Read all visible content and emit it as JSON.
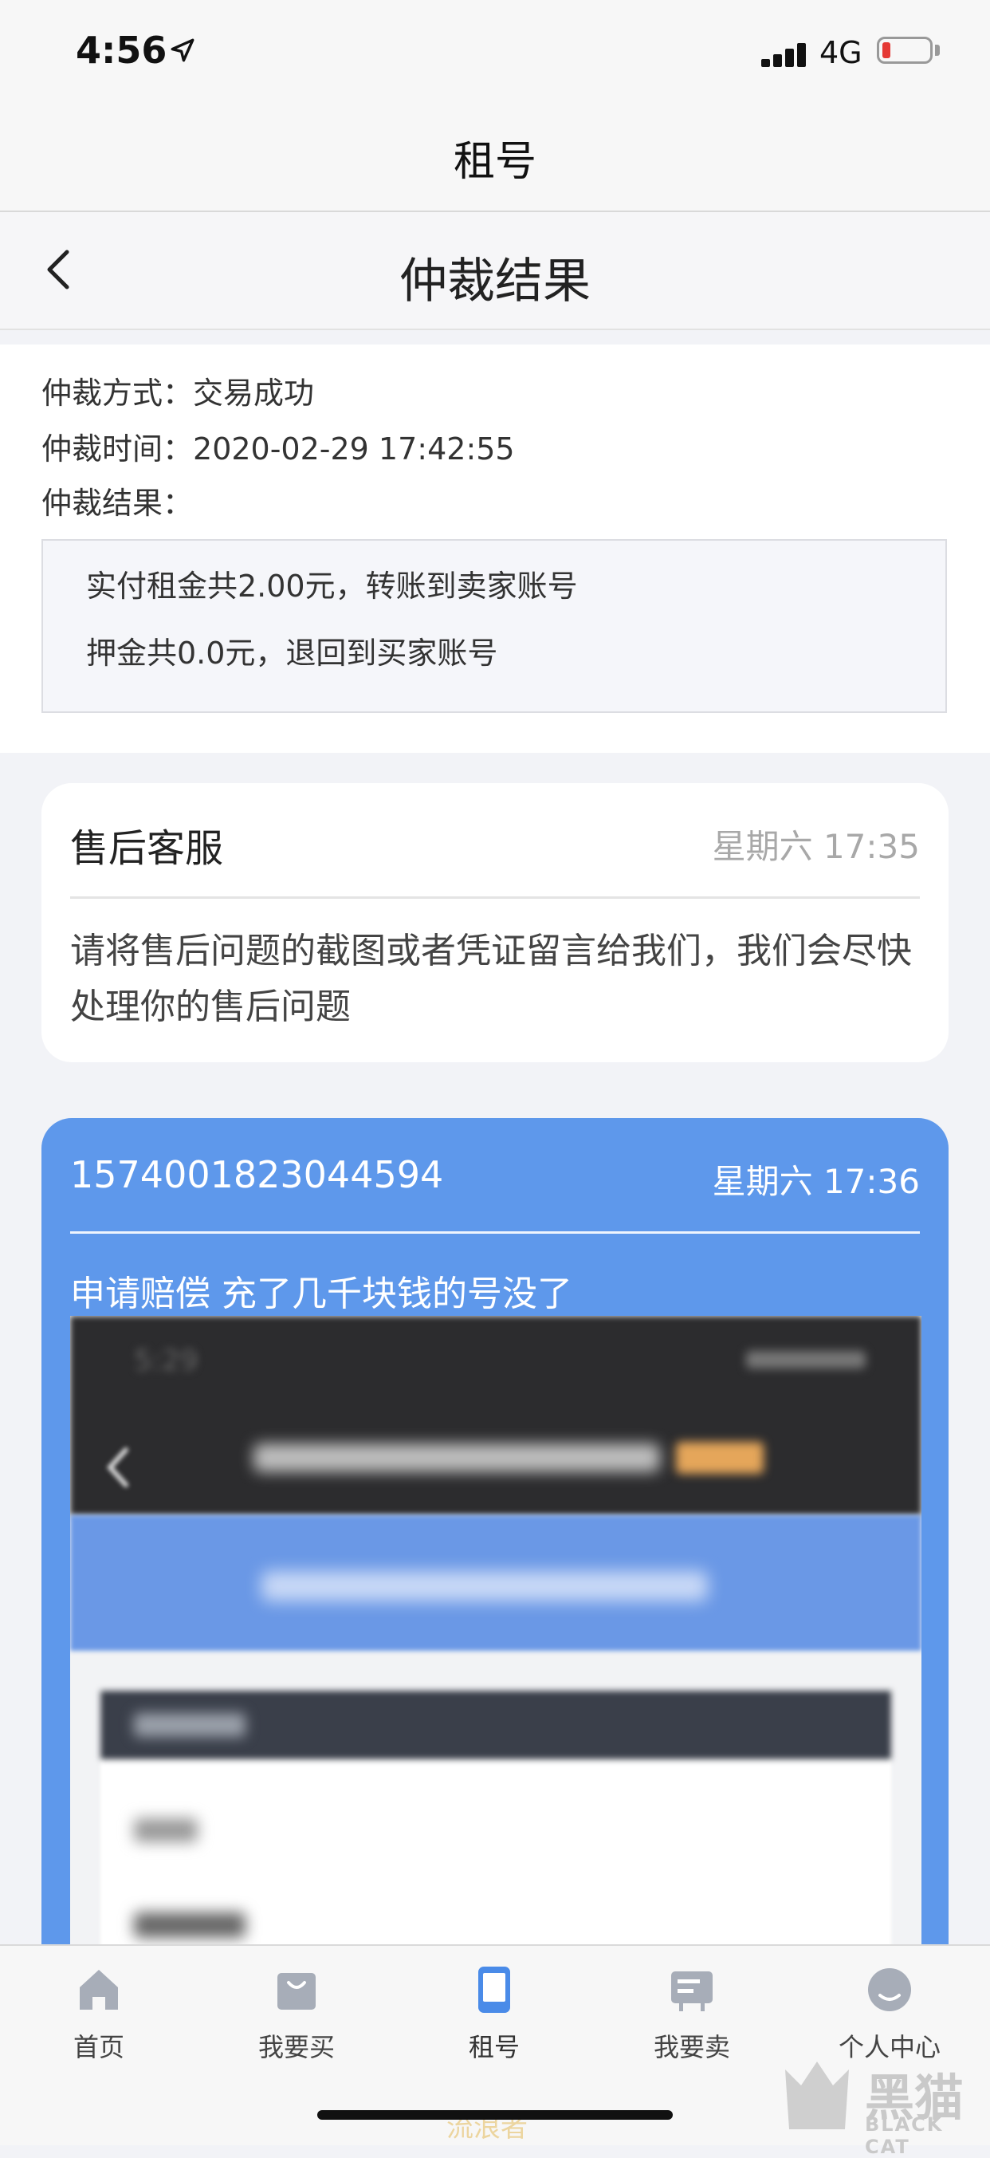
{
  "status_bar": {
    "time": "4:56",
    "network": "4G"
  },
  "app_header": {
    "title": "租号"
  },
  "page_nav": {
    "title": "仲裁结果"
  },
  "arbitration": {
    "method_label": "仲裁方式：",
    "method_value": "交易成功",
    "time_label": "仲裁时间：",
    "time_value": "2020-02-29 17:42:55",
    "result_label": "仲裁结果：",
    "result_lines": [
      "实付租金共2.00元，转账到卖家账号",
      "押金共0.0元，退回到买家账号"
    ]
  },
  "customer_service": {
    "name": "售后客服",
    "time": "星期六 17:35",
    "message": "请将售后问题的截图或者凭证留言给我们，我们会尽快处理你的售后问题"
  },
  "user_message": {
    "sender_id": "15740018230​44594",
    "time": "星期六 17:36",
    "text": "申请赔偿 充了几千块钱的号没了"
  },
  "tab_bar": {
    "items": [
      {
        "label": "首页",
        "icon": "home-icon"
      },
      {
        "label": "我要买",
        "icon": "shopping-bag-icon"
      },
      {
        "label": "租号",
        "icon": "phone-icon"
      },
      {
        "label": "我要卖",
        "icon": "sell-sign-icon"
      },
      {
        "label": "个人中心",
        "icon": "profile-icon"
      }
    ],
    "active_index": 2
  },
  "watermark": {
    "brand": "黑猫",
    "brand_en": "BLACK CAT",
    "mid_text": "流浪者"
  },
  "colors": {
    "accent_blue": "#5e98eb",
    "battery_low": "#e53935",
    "tab_active": "#4a8be8"
  }
}
